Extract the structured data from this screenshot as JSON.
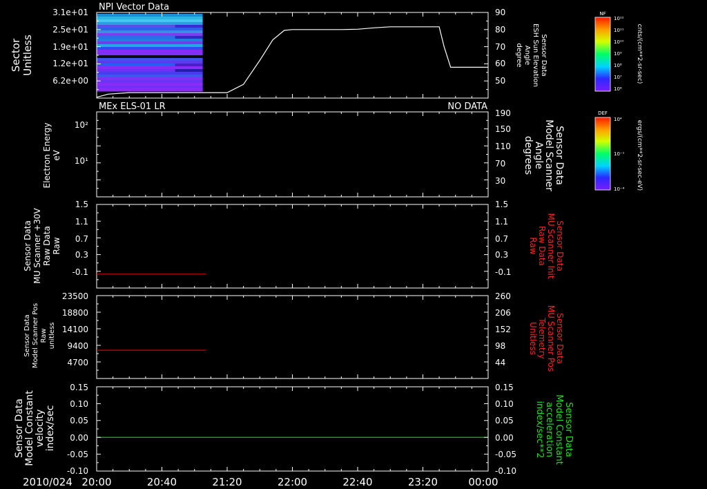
{
  "colors": {
    "background": "#000000",
    "axes": "#ffffff",
    "energy_trace": "#ffffff",
    "scanner_trace": "#cc0000",
    "right_label_red": "#ff2020",
    "velocity_trace": "#22cc22",
    "right_label_green": "#22dd22"
  },
  "chart_data": [
    {
      "id": "npi",
      "type": "heatmap",
      "title": "NPI Vector Data",
      "ylabel": [
        "Sector",
        "Unitless"
      ],
      "yticks": [
        "3.1e+01",
        "2.5e+01",
        "1.9e+01",
        "1.2e+01",
        "6.2e+00"
      ],
      "right_label": [
        "Sensor Data",
        "ESH Sun Elevation",
        "Angle",
        "degree"
      ],
      "right_ylim": [
        40,
        90
      ],
      "right_yticks": [
        "50",
        "60",
        "70",
        "80",
        "90"
      ],
      "colorbar": {
        "label": "NF",
        "units": "cnts/(cm**2-sr-sec)",
        "ticks": [
          "10¹²",
          "10¹¹",
          "10¹⁰",
          "10⁹",
          "10⁸",
          "10⁷",
          "10⁶"
        ]
      },
      "heatmap_x_range": [
        "20:00",
        "21:05"
      ],
      "line_series": {
        "name": "ESH Sun Elevation",
        "x": [
          "20:00",
          "20:07",
          "20:20",
          "21:05",
          "21:20",
          "21:30",
          "21:40",
          "21:48",
          "21:55",
          "22:00",
          "22:30",
          "22:40",
          "22:50",
          "23:00",
          "23:20",
          "23:30",
          "23:33",
          "23:37",
          "23:45",
          "24:00"
        ],
        "y": [
          40.5,
          42.3,
          43.2,
          43.2,
          43.2,
          48,
          62,
          74,
          79.5,
          80,
          80,
          80.2,
          81,
          81.6,
          81.6,
          81.6,
          70,
          58,
          58,
          58
        ]
      }
    },
    {
      "id": "els",
      "type": "line",
      "title": "MEx ELS-01 LR",
      "status": "NO DATA",
      "ylabel": [
        "Electron Energy",
        "eV"
      ],
      "yscale": "log",
      "ylim": [
        1.5,
        180
      ],
      "yticks": [
        "10²",
        "10¹"
      ],
      "right_label": [
        "Sensor Data",
        "Model Scanner",
        "Angle",
        "degrees"
      ],
      "right_ylim": [
        10,
        190
      ],
      "right_yticks": [
        "190",
        "150",
        "110",
        "70",
        "30"
      ],
      "colorbar": {
        "label": "DEF",
        "units": "ergs/(cm**2-sr-sec-eV)",
        "ticks": [
          "10⁴",
          "10⁻¹",
          "10⁻⁴"
        ]
      },
      "series": [
        {
          "name": "Model Scanner Angle",
          "x": [
            "20:00",
            "24:00"
          ],
          "y": [
            10,
            10
          ]
        }
      ]
    },
    {
      "id": "mu_scanner",
      "type": "line",
      "ylabel": [
        "Sensor Data",
        "MU Scanner +30V",
        "Raw Data",
        "Raw"
      ],
      "ylim": [
        -0.3,
        1.5
      ],
      "yticks": [
        "1.5",
        "1.1",
        "0.7",
        "0.3",
        "-0.1"
      ],
      "right_label": [
        "Sensor Data",
        "MU Scanner Init",
        "Raw Data",
        "Raw"
      ],
      "right_yticks": [
        "1.5",
        "1.1",
        "0.7",
        "0.3",
        "-0.1"
      ],
      "series": [
        {
          "name": "MU Scanner Init",
          "x": [
            "20:00",
            "21:07"
          ],
          "y": [
            0.0,
            0.0
          ]
        }
      ]
    },
    {
      "id": "scanner_pos",
      "type": "line",
      "ylabel": [
        "Sensor Data",
        "Model Scanner Pos",
        "Raw",
        "unitless"
      ],
      "ylim": [
        0,
        23500
      ],
      "yticks": [
        "23500",
        "18800",
        "14100",
        "9400",
        "4700"
      ],
      "right_label": [
        "Sensor Data",
        "MU Scanner Pos",
        "Telemetry",
        "Unitless"
      ],
      "right_yticks": [
        "260",
        "206",
        "152",
        "98",
        "44"
      ],
      "series": [
        {
          "name": "MU Scanner Pos",
          "x": [
            "20:00",
            "21:07"
          ],
          "y": [
            8000,
            8000
          ]
        }
      ]
    },
    {
      "id": "velocity",
      "type": "line",
      "ylabel": [
        "Sensor Data",
        "Model Constant",
        "velocity",
        "index/sec"
      ],
      "ylim": [
        -0.1,
        0.15
      ],
      "yticks": [
        "0.15",
        "0.10",
        "0.05",
        "0.00",
        "-0.05",
        "-0.10"
      ],
      "right_label": [
        "Sensor Data",
        "Model Constant",
        "acceleration",
        "index/sec**2"
      ],
      "right_yticks": [
        "0.15",
        "0.10",
        "0.05",
        "0.00",
        "-0.05",
        "-0.10"
      ],
      "series": [
        {
          "name": "Model Constant acceleration",
          "x": [
            "20:00",
            "24:00"
          ],
          "y": [
            0.0,
            0.0
          ]
        }
      ]
    }
  ],
  "x_axis": {
    "date": "2010/024",
    "ticks": [
      "20:00",
      "20:40",
      "21:20",
      "22:00",
      "22:40",
      "23:20",
      "00:00"
    ]
  }
}
